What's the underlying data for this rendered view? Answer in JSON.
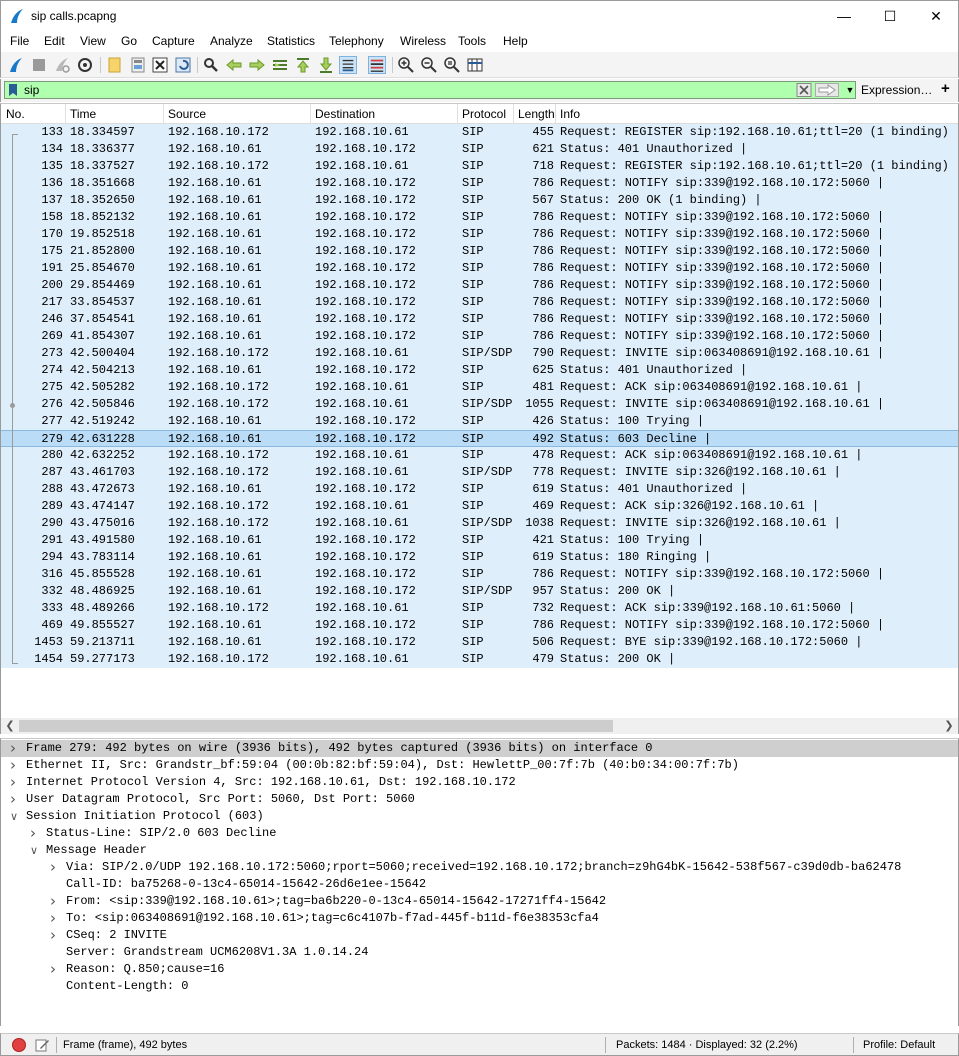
{
  "window": {
    "title": "sip calls.pcapng",
    "minimize": "—",
    "maximize": "☐",
    "close": "✕"
  },
  "menu": [
    "File",
    "Edit",
    "View",
    "Go",
    "Capture",
    "Analyze",
    "Statistics",
    "Telephony",
    "Wireless",
    "Tools",
    "Help"
  ],
  "filter": {
    "value": "sip",
    "expression_label": "Expression…",
    "add_label": "+"
  },
  "columns": [
    "No.",
    "Time",
    "Source",
    "Destination",
    "Protocol",
    "Length",
    "Info"
  ],
  "packets": [
    {
      "no": "133",
      "time": "18.334597",
      "src": "192.168.10.172",
      "dst": "192.168.10.61",
      "proto": "SIP",
      "len": "455",
      "info": "Request: REGISTER sip:192.168.10.61;ttl=20  (1 binding) |"
    },
    {
      "no": "134",
      "time": "18.336377",
      "src": "192.168.10.61",
      "dst": "192.168.10.172",
      "proto": "SIP",
      "len": "621",
      "info": "Status: 401 Unauthorized |"
    },
    {
      "no": "135",
      "time": "18.337527",
      "src": "192.168.10.172",
      "dst": "192.168.10.61",
      "proto": "SIP",
      "len": "718",
      "info": "Request: REGISTER sip:192.168.10.61;ttl=20  (1 binding) |"
    },
    {
      "no": "136",
      "time": "18.351668",
      "src": "192.168.10.61",
      "dst": "192.168.10.172",
      "proto": "SIP",
      "len": "786",
      "info": "Request: NOTIFY sip:339@192.168.10.172:5060 |"
    },
    {
      "no": "137",
      "time": "18.352650",
      "src": "192.168.10.61",
      "dst": "192.168.10.172",
      "proto": "SIP",
      "len": "567",
      "info": "Status: 200 OK  (1 binding) |"
    },
    {
      "no": "158",
      "time": "18.852132",
      "src": "192.168.10.61",
      "dst": "192.168.10.172",
      "proto": "SIP",
      "len": "786",
      "info": "Request: NOTIFY sip:339@192.168.10.172:5060 |"
    },
    {
      "no": "170",
      "time": "19.852518",
      "src": "192.168.10.61",
      "dst": "192.168.10.172",
      "proto": "SIP",
      "len": "786",
      "info": "Request: NOTIFY sip:339@192.168.10.172:5060 |"
    },
    {
      "no": "175",
      "time": "21.852800",
      "src": "192.168.10.61",
      "dst": "192.168.10.172",
      "proto": "SIP",
      "len": "786",
      "info": "Request: NOTIFY sip:339@192.168.10.172:5060 |"
    },
    {
      "no": "191",
      "time": "25.854670",
      "src": "192.168.10.61",
      "dst": "192.168.10.172",
      "proto": "SIP",
      "len": "786",
      "info": "Request: NOTIFY sip:339@192.168.10.172:5060 |"
    },
    {
      "no": "200",
      "time": "29.854469",
      "src": "192.168.10.61",
      "dst": "192.168.10.172",
      "proto": "SIP",
      "len": "786",
      "info": "Request: NOTIFY sip:339@192.168.10.172:5060 |"
    },
    {
      "no": "217",
      "time": "33.854537",
      "src": "192.168.10.61",
      "dst": "192.168.10.172",
      "proto": "SIP",
      "len": "786",
      "info": "Request: NOTIFY sip:339@192.168.10.172:5060 |"
    },
    {
      "no": "246",
      "time": "37.854541",
      "src": "192.168.10.61",
      "dst": "192.168.10.172",
      "proto": "SIP",
      "len": "786",
      "info": "Request: NOTIFY sip:339@192.168.10.172:5060 |"
    },
    {
      "no": "269",
      "time": "41.854307",
      "src": "192.168.10.61",
      "dst": "192.168.10.172",
      "proto": "SIP",
      "len": "786",
      "info": "Request: NOTIFY sip:339@192.168.10.172:5060 |"
    },
    {
      "no": "273",
      "time": "42.500404",
      "src": "192.168.10.172",
      "dst": "192.168.10.61",
      "proto": "SIP/SDP",
      "len": "790",
      "info": "Request: INVITE sip:063408691@192.168.10.61 |"
    },
    {
      "no": "274",
      "time": "42.504213",
      "src": "192.168.10.61",
      "dst": "192.168.10.172",
      "proto": "SIP",
      "len": "625",
      "info": "Status: 401 Unauthorized |"
    },
    {
      "no": "275",
      "time": "42.505282",
      "src": "192.168.10.172",
      "dst": "192.168.10.61",
      "proto": "SIP",
      "len": "481",
      "info": "Request: ACK sip:063408691@192.168.10.61 |"
    },
    {
      "no": "276",
      "time": "42.505846",
      "src": "192.168.10.172",
      "dst": "192.168.10.61",
      "proto": "SIP/SDP",
      "len": "1055",
      "info": "Request: INVITE sip:063408691@192.168.10.61 |"
    },
    {
      "no": "277",
      "time": "42.519242",
      "src": "192.168.10.61",
      "dst": "192.168.10.172",
      "proto": "SIP",
      "len": "426",
      "info": "Status: 100 Trying |"
    },
    {
      "no": "279",
      "time": "42.631228",
      "src": "192.168.10.61",
      "dst": "192.168.10.172",
      "proto": "SIP",
      "len": "492",
      "info": "Status: 603 Decline |"
    },
    {
      "no": "280",
      "time": "42.632252",
      "src": "192.168.10.172",
      "dst": "192.168.10.61",
      "proto": "SIP",
      "len": "478",
      "info": "Request: ACK sip:063408691@192.168.10.61 |"
    },
    {
      "no": "287",
      "time": "43.461703",
      "src": "192.168.10.172",
      "dst": "192.168.10.61",
      "proto": "SIP/SDP",
      "len": "778",
      "info": "Request: INVITE sip:326@192.168.10.61 |"
    },
    {
      "no": "288",
      "time": "43.472673",
      "src": "192.168.10.61",
      "dst": "192.168.10.172",
      "proto": "SIP",
      "len": "619",
      "info": "Status: 401 Unauthorized |"
    },
    {
      "no": "289",
      "time": "43.474147",
      "src": "192.168.10.172",
      "dst": "192.168.10.61",
      "proto": "SIP",
      "len": "469",
      "info": "Request: ACK sip:326@192.168.10.61 |"
    },
    {
      "no": "290",
      "time": "43.475016",
      "src": "192.168.10.172",
      "dst": "192.168.10.61",
      "proto": "SIP/SDP",
      "len": "1038",
      "info": "Request: INVITE sip:326@192.168.10.61 |"
    },
    {
      "no": "291",
      "time": "43.491580",
      "src": "192.168.10.61",
      "dst": "192.168.10.172",
      "proto": "SIP",
      "len": "421",
      "info": "Status: 100 Trying |"
    },
    {
      "no": "294",
      "time": "43.783114",
      "src": "192.168.10.61",
      "dst": "192.168.10.172",
      "proto": "SIP",
      "len": "619",
      "info": "Status: 180 Ringing |"
    },
    {
      "no": "316",
      "time": "45.855528",
      "src": "192.168.10.61",
      "dst": "192.168.10.172",
      "proto": "SIP",
      "len": "786",
      "info": "Request: NOTIFY sip:339@192.168.10.172:5060 |"
    },
    {
      "no": "332",
      "time": "48.486925",
      "src": "192.168.10.61",
      "dst": "192.168.10.172",
      "proto": "SIP/SDP",
      "len": "957",
      "info": "Status: 200 OK |"
    },
    {
      "no": "333",
      "time": "48.489266",
      "src": "192.168.10.172",
      "dst": "192.168.10.61",
      "proto": "SIP",
      "len": "732",
      "info": "Request: ACK sip:339@192.168.10.61:5060 |"
    },
    {
      "no": "469",
      "time": "49.855527",
      "src": "192.168.10.61",
      "dst": "192.168.10.172",
      "proto": "SIP",
      "len": "786",
      "info": "Request: NOTIFY sip:339@192.168.10.172:5060 |"
    },
    {
      "no": "1453",
      "time": "59.213711",
      "src": "192.168.10.61",
      "dst": "192.168.10.172",
      "proto": "SIP",
      "len": "506",
      "info": "Request: BYE sip:339@192.168.10.172:5060 |"
    },
    {
      "no": "1454",
      "time": "59.277173",
      "src": "192.168.10.172",
      "dst": "192.168.10.61",
      "proto": "SIP",
      "len": "479",
      "info": "Status: 200 OK |"
    }
  ],
  "selected_packet": "279",
  "details": [
    {
      "indent": 0,
      "twisty": ">",
      "text": "Frame 279: 492 bytes on wire (3936 bits), 492 bytes captured (3936 bits) on interface 0",
      "selected": true
    },
    {
      "indent": 0,
      "twisty": ">",
      "text": "Ethernet II, Src: Grandstr_bf:59:04 (00:0b:82:bf:59:04), Dst: HewlettP_00:7f:7b (40:b0:34:00:7f:7b)"
    },
    {
      "indent": 0,
      "twisty": ">",
      "text": "Internet Protocol Version 4, Src: 192.168.10.61, Dst: 192.168.10.172"
    },
    {
      "indent": 0,
      "twisty": ">",
      "text": "User Datagram Protocol, Src Port: 5060, Dst Port: 5060"
    },
    {
      "indent": 0,
      "twisty": "v",
      "text": "Session Initiation Protocol (603)"
    },
    {
      "indent": 1,
      "twisty": ">",
      "text": "Status-Line: SIP/2.0 603 Decline"
    },
    {
      "indent": 1,
      "twisty": "v",
      "text": "Message Header"
    },
    {
      "indent": 2,
      "twisty": ">",
      "text": "Via: SIP/2.0/UDP 192.168.10.172:5060;rport=5060;received=192.168.10.172;branch=z9hG4bK-15642-538f567-c39d0db-ba62478"
    },
    {
      "indent": 2,
      "twisty": "",
      "text": "Call-ID: ba75268-0-13c4-65014-15642-26d6e1ee-15642"
    },
    {
      "indent": 2,
      "twisty": ">",
      "text": "From: <sip:339@192.168.10.61>;tag=ba6b220-0-13c4-65014-15642-17271ff4-15642"
    },
    {
      "indent": 2,
      "twisty": ">",
      "text": "To: <sip:063408691@192.168.10.61>;tag=c6c4107b-f7ad-445f-b11d-f6e38353cfa4"
    },
    {
      "indent": 2,
      "twisty": ">",
      "text": "CSeq: 2 INVITE"
    },
    {
      "indent": 2,
      "twisty": "",
      "text": "Server: Grandstream UCM6208V1.3A 1.0.14.24"
    },
    {
      "indent": 2,
      "twisty": ">",
      "text": "Reason: Q.850;cause=16"
    },
    {
      "indent": 2,
      "twisty": "",
      "text": "Content-Length:  0"
    }
  ],
  "status": {
    "frame_info": "Frame (frame), 492 bytes",
    "packets_info": "Packets: 1484 · Displayed: 32 (2.2%)",
    "profile": "Profile: Default"
  },
  "colors": {
    "row_bg": "#dfeefb",
    "selected_row_bg": "#bbdcf7",
    "filter_valid_bg": "#afffaf"
  }
}
